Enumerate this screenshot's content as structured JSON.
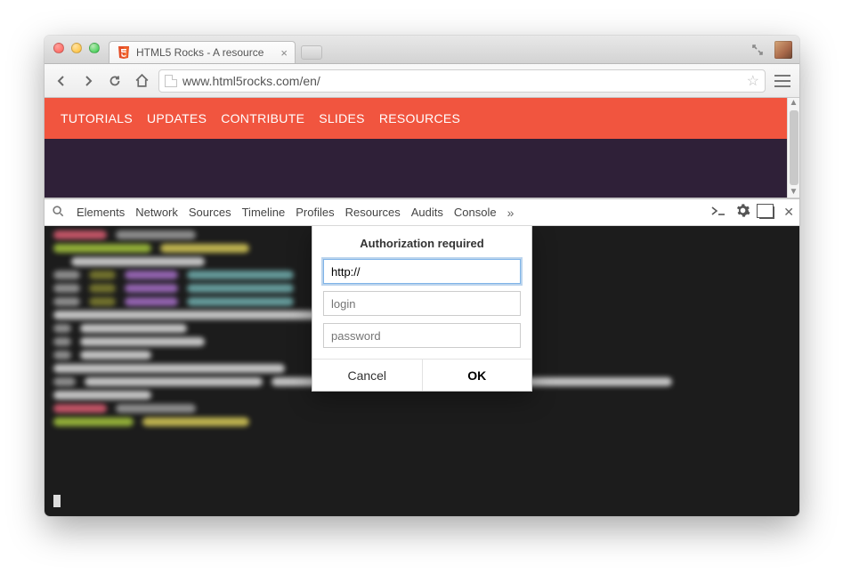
{
  "window": {
    "tab_title": "HTML5 Rocks - A resource",
    "url": "www.html5rocks.com/en/"
  },
  "site_nav": {
    "items": [
      "TUTORIALS",
      "UPDATES",
      "CONTRIBUTE",
      "SLIDES",
      "RESOURCES"
    ]
  },
  "devtools": {
    "tabs": [
      "Elements",
      "Network",
      "Sources",
      "Timeline",
      "Profiles",
      "Resources",
      "Audits",
      "Console"
    ]
  },
  "modal": {
    "title": "Authorization required",
    "url_value": "http://",
    "login_placeholder": "login",
    "password_placeholder": "password",
    "cancel_label": "Cancel",
    "ok_label": "OK"
  }
}
